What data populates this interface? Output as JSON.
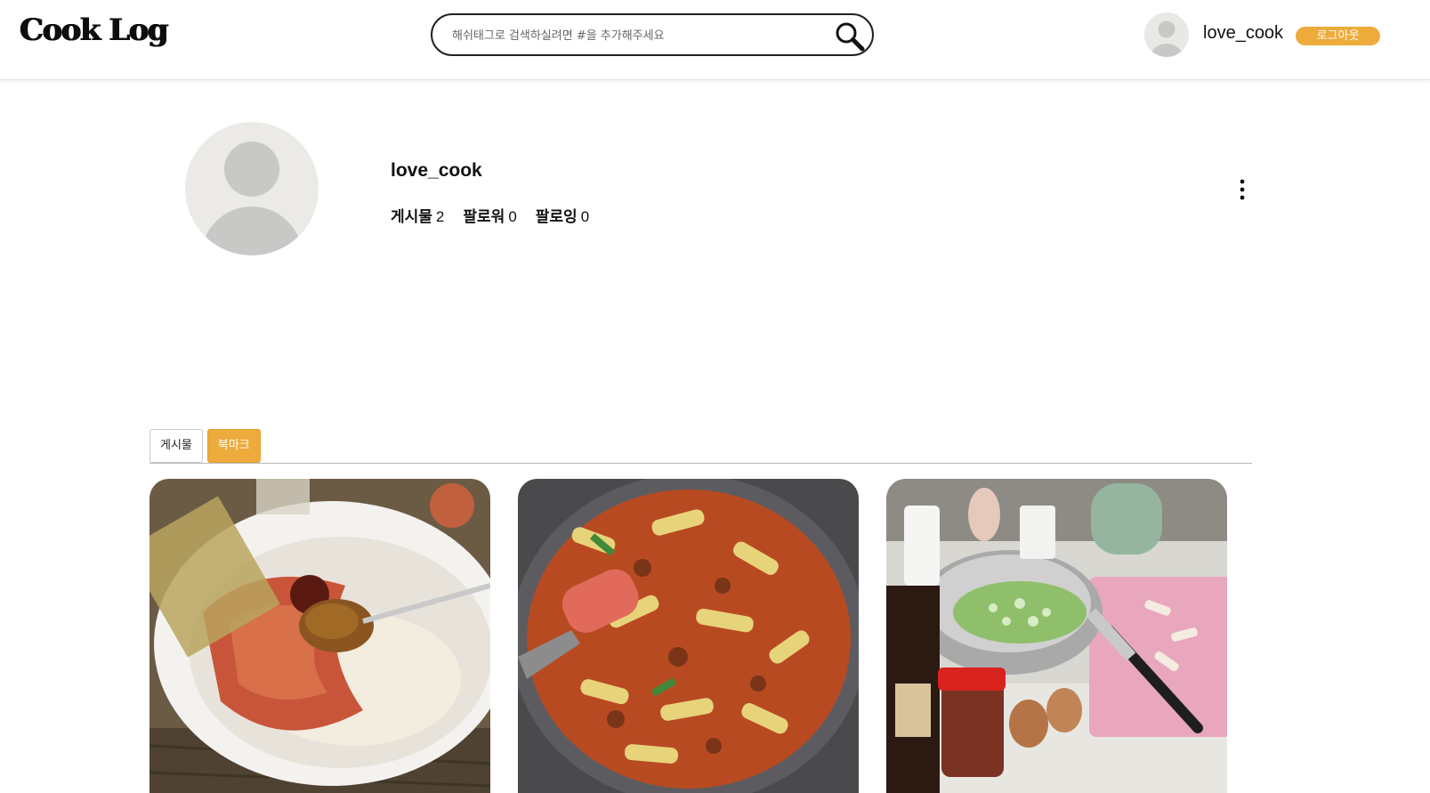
{
  "header": {
    "logo": "Cook Log",
    "search_placeholder": "해쉬태그로 검색하실려면 #을 추가해주세요",
    "username": "love_cook",
    "logout_label": "로그아웃"
  },
  "profile": {
    "username": "love_cook",
    "stats": [
      {
        "label": "게시물",
        "value": "2"
      },
      {
        "label": "팔로워",
        "value": "0"
      },
      {
        "label": "팔로잉",
        "value": "0"
      }
    ]
  },
  "tabs": [
    {
      "label": "게시물",
      "active": false
    },
    {
      "label": "북마크",
      "active": true
    }
  ],
  "colors": {
    "accent": "#edab3b"
  },
  "cards": [
    {
      "icon": "bibim-noodle-photo"
    },
    {
      "icon": "spicy-octopus-photo"
    },
    {
      "icon": "kitchen-ingredients-photo"
    }
  ]
}
